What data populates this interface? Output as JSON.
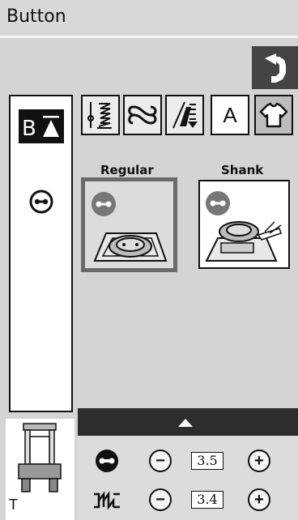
{
  "header": {
    "title": "Button"
  },
  "left_panel": {
    "mode_icon": "b-triangle-icon",
    "selected_icon": "button-icon"
  },
  "tabs": [
    {
      "icon": "straight-stitch-icon",
      "selected": false
    },
    {
      "icon": "decorative-stitch-icon",
      "selected": false
    },
    {
      "icon": "satin-stitch-icon",
      "selected": false
    },
    {
      "icon": "letter-a-icon",
      "label": "A",
      "selected": false
    },
    {
      "icon": "shirt-icon",
      "selected": true
    }
  ],
  "options": [
    {
      "label": "Regular",
      "selected": true
    },
    {
      "label": "Shank",
      "selected": false
    }
  ],
  "foot": {
    "label": "T"
  },
  "adjustments": [
    {
      "name": "button-width",
      "value": "3.5"
    },
    {
      "name": "stitch-count",
      "value": "3.4"
    }
  ],
  "colors": {
    "dark": "#2d2d2d",
    "panel": "#dcdcdc",
    "selected_border": "#6a6a6a"
  }
}
